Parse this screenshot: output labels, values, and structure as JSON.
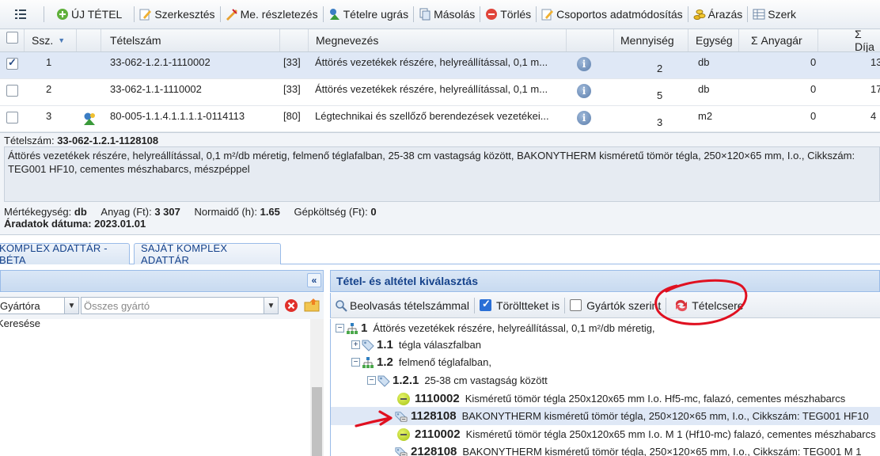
{
  "toolbar": {
    "items": [
      {
        "label": "ÚJ TÉTEL",
        "icon": "plus-circle-icon"
      },
      {
        "label": "Szerkesztés",
        "icon": "edit-icon"
      },
      {
        "label": "Me. részletezés",
        "icon": "ruler-icon"
      },
      {
        "label": "Tételre ugrás",
        "icon": "jump-icon"
      },
      {
        "label": "Másolás",
        "icon": "copy-icon"
      },
      {
        "label": "Törlés",
        "icon": "delete-icon"
      },
      {
        "label": "Csoportos adatmódosítás",
        "icon": "bulk-edit-icon"
      },
      {
        "label": "Árazás",
        "icon": "coins-icon"
      },
      {
        "label": "Szerk",
        "icon": "table-edit-icon"
      }
    ]
  },
  "grid": {
    "columns": {
      "ssz": "Ssz.",
      "tetelszam": "Tételszám",
      "megnevezes": "Megnevezés",
      "mennyiseg": "Mennyiség",
      "egyseg": "Egység",
      "anyagar": "Σ Anyagár",
      "dij": "Σ Díja"
    },
    "rows": [
      {
        "ssz": "1",
        "tetelszam": "33-062-1.2.1-1110002",
        "ref": "[33]",
        "megnevezes": "Áttörés vezetékek részére, helyreállítással, 0,1 m...",
        "mennyiseg": "2",
        "egyseg": "db",
        "anyagar": "0",
        "dij": "13",
        "checked": true
      },
      {
        "ssz": "2",
        "tetelszam": "33-062-1.1-1110002",
        "ref": "[33]",
        "megnevezes": "Áttörés vezetékek részére, helyreállítással, 0,1 m...",
        "mennyiseg": "5",
        "egyseg": "db",
        "anyagar": "0",
        "dij": "17",
        "checked": false
      },
      {
        "ssz": "3",
        "tetelszam": "80-005-1.1.4.1.1.1.1-0114113",
        "ref": "[80]",
        "megnevezes": "Légtechnikai és szellőző berendezések vezetékei...",
        "mennyiseg": "3",
        "egyseg": "m2",
        "anyagar": "0",
        "dij": "4",
        "checked": false
      }
    ]
  },
  "detail": {
    "tetelszam_label": "Tételszám:",
    "tetelszam_value": "33-062-1.2.1-1128108",
    "description": "Áttörés vezetékek részére, helyreállítással, 0,1 m²/db méretig, felmenő téglafalban, 25-38 cm vastagság között, BAKONYTHERM kisméretű tömör tégla, 250×120×65 mm, I.o., Cikkszám: TEG001 HF10, cementes mészhabarcs, mészpéppel",
    "me_label": "Mértékegység:",
    "me_value": "db",
    "anyag_label": "Anyag (Ft):",
    "anyag_value": "3 307",
    "normaido_label": "Normaidő (h):",
    "normaido_value": "1.65",
    "gep_label": "Gépköltség (Ft):",
    "gep_value": "0",
    "datum_label": "Áradatok dátuma:",
    "datum_value": "2023.01.01"
  },
  "tabs": [
    {
      "label": "KOMPLEX ADATTÁR - BÉTA"
    },
    {
      "label": "SAJÁT KOMPLEX ADATTÁR"
    }
  ],
  "left_panel": {
    "combo1_value": "Gyártóra",
    "combo2_placeholder": "Összes gyártó",
    "body_text": "Keresése"
  },
  "right_panel": {
    "title": "Tétel- és altétel kiválasztás",
    "tools": {
      "scan_label": "Beolvasás tételszámmal",
      "deleted_label": "Töröltteket is",
      "deleted_checked": true,
      "manufacturer_label": "Gyártók szerint",
      "manufacturer_checked": false,
      "replace_label": "Tételcsere"
    },
    "tree": [
      {
        "level": 0,
        "code": "1",
        "text": "Áttörés vezetékek részére, helyreállítással, 0,1 m²/db méretig,",
        "expander": "minus",
        "icon": "hierarchy-icon"
      },
      {
        "level": 1,
        "code": "1.1",
        "text": "tégla válaszfalban",
        "expander": "plus",
        "icon": "tag-icon"
      },
      {
        "level": 1,
        "code": "1.2",
        "text": "felmenő téglafalban,",
        "expander": "minus",
        "icon": "hierarchy-icon"
      },
      {
        "level": 2,
        "code": "1.2.1",
        "text": "25-38 cm vastagság között",
        "expander": "minus",
        "icon": "tag-icon"
      },
      {
        "level": 3,
        "code": "1110002",
        "text": "Kisméretű tömör tégla 250x120x65 mm I.o. Hf5-mc, falazó, cementes mészhabarcs",
        "icon": "status-dot-icon"
      },
      {
        "level": 3,
        "code": "1128108",
        "text": "BAKONYTHERM kisméretű tömör tégla, 250×120×65 mm, I.o., Cikkszám: TEG001 HF10",
        "icon": "linked-tag-icon",
        "highlight": true
      },
      {
        "level": 3,
        "code": "2110002",
        "text": "Kisméretű tömör tégla 250x120x65 mm I.o. M 1 (Hf10-mc) falazó, cementes mészhabarcs",
        "icon": "status-dot-icon"
      },
      {
        "level": 3,
        "code": "2128108",
        "text": "BAKONYTHERM kisméretű tömör tégla, 250×120×65 mm, I.o., Cikkszám: TEG001 M 1",
        "icon": "linked-tag-icon"
      }
    ]
  },
  "annotation_color": "#e01020"
}
